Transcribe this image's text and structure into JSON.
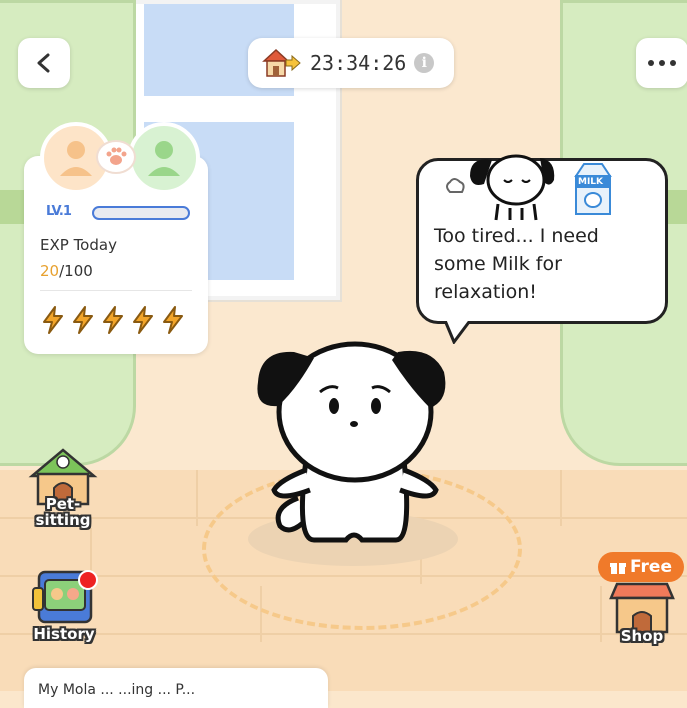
{
  "header": {
    "timer": "23:34:26",
    "back_icon": "chevron-left-icon",
    "more_icon": "ellipsis-icon",
    "home_icon": "house-arrow-icon",
    "info_icon": "info-icon",
    "info_glyph": "i"
  },
  "pet_card": {
    "level_label": "LV.1",
    "exp_title": "EXP Today",
    "exp_current": "20",
    "exp_max": "/100",
    "exp_progress": 0.0,
    "energy_count": 5
  },
  "speech": {
    "text": "Too tired... I need some Milk for relaxation!",
    "milk_label": "MILK",
    "colors": {
      "outline": "#222222",
      "milk": "#3a8ad8"
    }
  },
  "side_buttons": {
    "petsitting_label": "Pet-\nsitting",
    "history_label": "History",
    "shop_label": "Shop",
    "free_label": "Free"
  },
  "bottom": {
    "text": "My Mola ... ...ing ... P..."
  },
  "colors": {
    "accent_blue": "#4a7bd8",
    "energy_orange": "#f2a52a",
    "free_orange": "#f07a2a",
    "curtain_green": "#d6ecc0",
    "wall": "#fbe8cf",
    "floor": "#f9dcb8"
  }
}
